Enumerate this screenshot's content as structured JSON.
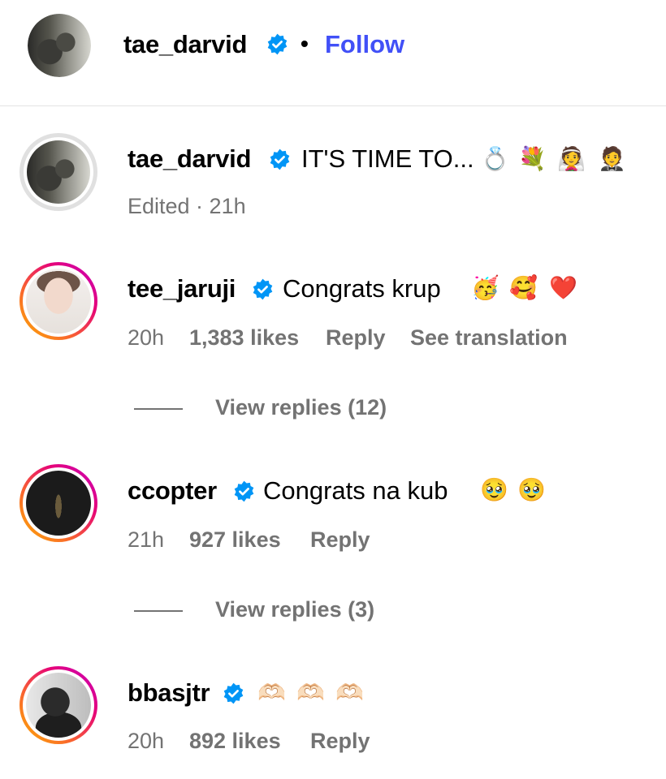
{
  "header": {
    "username": "tae_darvid",
    "separator": "•",
    "follow_label": "Follow"
  },
  "caption": {
    "username": "tae_darvid",
    "text": "IT'S TIME TO...",
    "emojis": [
      "💍",
      "💐",
      "👰",
      "🤵"
    ],
    "meta": "Edited · 21h"
  },
  "comments": [
    {
      "username": "tee_jaruji",
      "text": "Congrats krup",
      "emojis": [
        "🥳",
        "🥰",
        "❤️"
      ],
      "time": "20h",
      "likes": "1,383 likes",
      "reply_label": "Reply",
      "translation_label": "See translation",
      "view_replies": "View replies (12)"
    },
    {
      "username": "ccopter",
      "text": "Congrats na kub",
      "emojis": [
        "🥹",
        "🥹"
      ],
      "time": "21h",
      "likes": "927 likes",
      "reply_label": "Reply",
      "view_replies": "View replies (3)"
    },
    {
      "username": "bbasjtr",
      "text": "",
      "emojis": [
        "🫶🏻",
        "🫶🏻",
        "🫶🏻"
      ],
      "time": "20h",
      "likes": "892 likes",
      "reply_label": "Reply"
    }
  ],
  "colors": {
    "follow": "#4150f7",
    "verified": "#0095f6",
    "muted": "#737373"
  }
}
